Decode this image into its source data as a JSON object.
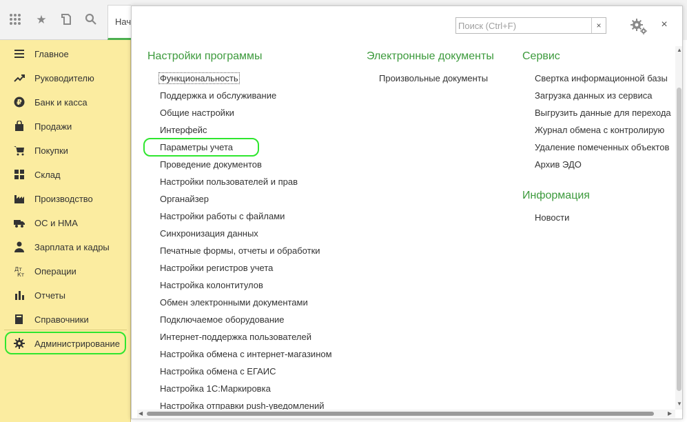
{
  "toolbar": {
    "icons": [
      "apps-grid-icon",
      "star-icon",
      "history-icon",
      "search-icon"
    ],
    "tab_label": "Начальная страница"
  },
  "sidebar": {
    "items": [
      {
        "label": "Главное",
        "icon": "menu-lines-icon"
      },
      {
        "label": "Руководителю",
        "icon": "trend-chart-icon"
      },
      {
        "label": "Банк и касса",
        "icon": "ruble-coin-icon"
      },
      {
        "label": "Продажи",
        "icon": "shopping-bag-icon"
      },
      {
        "label": "Покупки",
        "icon": "cart-icon"
      },
      {
        "label": "Склад",
        "icon": "warehouse-boxes-icon"
      },
      {
        "label": "Производство",
        "icon": "factory-icon"
      },
      {
        "label": "ОС и НМА",
        "icon": "truck-icon"
      },
      {
        "label": "Зарплата и кадры",
        "icon": "person-icon"
      },
      {
        "label": "Операции",
        "icon": "dt-kt-icon"
      },
      {
        "label": "Отчеты",
        "icon": "bar-chart-icon"
      },
      {
        "label": "Справочники",
        "icon": "book-icon"
      },
      {
        "label": "Администрирование",
        "icon": "gear-icon",
        "selected": true
      }
    ]
  },
  "search": {
    "placeholder": "Поиск (Ctrl+F)",
    "value": "",
    "clear_glyph": "×"
  },
  "close_glyph": "×",
  "sections": {
    "settings": {
      "title": "Настройки программы",
      "links": [
        "Функциональность",
        "Поддержка и обслуживание",
        "Общие настройки",
        "Интерфейс",
        "Параметры учета",
        "Проведение документов",
        "Настройки пользователей и прав",
        "Органайзер",
        "Настройки работы с файлами",
        "Синхронизация данных",
        "Печатные формы, отчеты и обработки",
        "Настройки регистров учета",
        "Настройка колонтитулов",
        "Обмен электронными документами",
        "Подключаемое оборудование",
        "Интернет-поддержка пользователей",
        "Настройка обмена с интернет-магазином",
        "Настройка обмена с ЕГАИС",
        "Настройка 1С:Маркировка",
        "Настройка отправки push-уведомлений"
      ]
    },
    "edocs": {
      "title": "Электронные документы",
      "links": [
        "Произвольные документы"
      ]
    },
    "service": {
      "title": "Сервис",
      "links": [
        "Свертка информационной базы",
        "Загрузка данных из сервиса",
        "Выгрузить данные для перехода",
        "Журнал обмена с контролирую",
        "Удаление помеченных объектов",
        "Архив ЭДО"
      ]
    },
    "info": {
      "title": "Информация",
      "links": [
        "Новости"
      ]
    }
  },
  "colors": {
    "sidebar_bg": "#fbeca0",
    "heading_green": "#3c9a3c",
    "highlight_green": "#2ee62e"
  }
}
